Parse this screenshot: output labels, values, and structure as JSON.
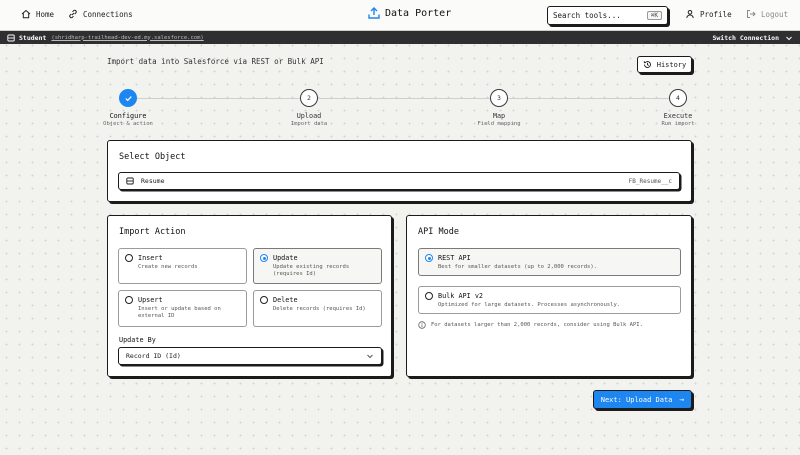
{
  "nav": {
    "home": "Home",
    "connections": "Connections",
    "brand": "Data Porter",
    "search_placeholder": "Search tools...",
    "search_shortcut": "⌘K",
    "profile": "Profile",
    "logout": "Logout"
  },
  "student_bar": {
    "label": "Student",
    "org_url": "(shridharp-trailhead-dev-ed.my.salesforce.com)",
    "switch_label": "Switch Connection"
  },
  "page": {
    "subtitle": "Import data into Salesforce via REST or Bulk API",
    "history_label": "History"
  },
  "steps": [
    {
      "number": "1",
      "title": "Configure",
      "desc": "Object & action",
      "status": "done"
    },
    {
      "number": "2",
      "title": "Upload",
      "desc": "Import data",
      "status": "pending"
    },
    {
      "number": "3",
      "title": "Map",
      "desc": "Field mapping",
      "status": "pending"
    },
    {
      "number": "4",
      "title": "Execute",
      "desc": "Run import",
      "status": "pending"
    }
  ],
  "select_object": {
    "title": "Select Object",
    "selected_label": "Resume",
    "selected_api": "FB_Resume__c"
  },
  "import_action": {
    "title": "Import Action",
    "options": [
      {
        "title": "Insert",
        "desc": "Create new records",
        "selected": false
      },
      {
        "title": "Update",
        "desc": "Update existing records (requires Id)",
        "selected": true
      },
      {
        "title": "Upsert",
        "desc": "Insert or update based on external ID",
        "selected": false
      },
      {
        "title": "Delete",
        "desc": "Delete records (requires Id)",
        "selected": false
      }
    ],
    "update_by_label": "Update By",
    "update_by_value": "Record ID (Id)"
  },
  "api_mode": {
    "title": "API Mode",
    "options": [
      {
        "title": "REST API",
        "desc": "Best for smaller datasets (up to 2,000 records).",
        "selected": true
      },
      {
        "title": "Bulk API v2",
        "desc": "Optimized for large datasets. Processes asynchronously.",
        "selected": false
      }
    ],
    "note": "For datasets larger than 2,000 records, consider using Bulk API."
  },
  "next_button": {
    "label": "Next: Upload Data",
    "arrow": "→"
  },
  "colors": {
    "accent": "#1e86f0",
    "border": "#1b1b1b",
    "student_bar": "#2f2f31"
  }
}
